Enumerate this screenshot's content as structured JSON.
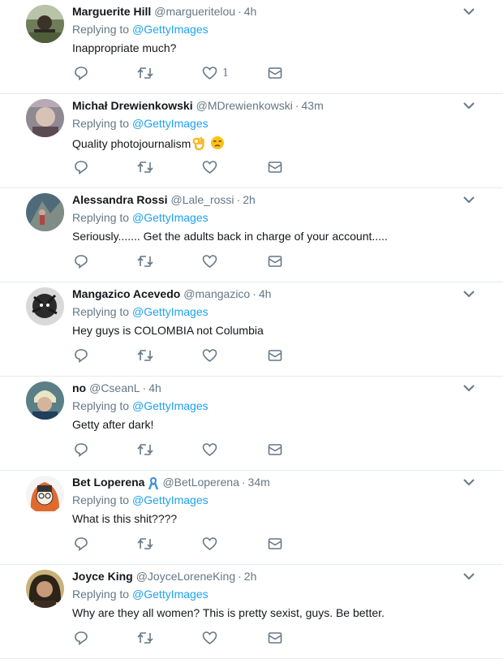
{
  "tweets": [
    {
      "name": "Marguerite Hill",
      "handle": "@margueritelou",
      "sep": "·",
      "time": "4h",
      "replying_prefix": "Replying to",
      "replying_to": "@GettyImages",
      "text": "Inappropriate much?",
      "like_count": "1"
    },
    {
      "name": "Michał Drewienkowski",
      "handle": "@MDrewienkowski",
      "sep": "·",
      "time": "43m",
      "replying_prefix": "Replying to",
      "replying_to": "@GettyImages",
      "text": "Quality photojournalism",
      "like_count": ""
    },
    {
      "name": "Alessandra Rossi",
      "handle": "@Lale_rossi",
      "sep": "·",
      "time": "2h",
      "replying_prefix": "Replying to",
      "replying_to": "@GettyImages",
      "text": "Seriously....... Get the adults back in charge of your account.....",
      "like_count": ""
    },
    {
      "name": "Mangazico Acevedo",
      "handle": "@mangazico",
      "sep": "·",
      "time": "4h",
      "replying_prefix": "Replying to",
      "replying_to": "@GettyImages",
      "text": "Hey guys is COLOMBIA not Columbia",
      "like_count": ""
    },
    {
      "name": "no",
      "handle": "@CseanL",
      "sep": "·",
      "time": "4h",
      "replying_prefix": "Replying to",
      "replying_to": "@GettyImages",
      "text": "Getty after dark!",
      "like_count": ""
    },
    {
      "name": "Bet Loperena",
      "handle": "@BetLoperena",
      "sep": "·",
      "time": "34m",
      "replying_prefix": "Replying to",
      "replying_to": "@GettyImages",
      "text": "What is this shit????",
      "like_count": ""
    },
    {
      "name": "Joyce King",
      "handle": "@JoyceLoreneKing",
      "sep": "·",
      "time": "2h",
      "replying_prefix": "Replying to",
      "replying_to": "@GettyImages",
      "text": "Why are they all women? This is pretty sexist, guys. Be better.",
      "like_count": ""
    }
  ],
  "icons": {
    "reply": "reply-icon",
    "retweet": "retweet-icon",
    "like": "heart-icon",
    "dm": "envelope-icon",
    "more": "chevron-down-icon",
    "ribbon": "ribbon-icon",
    "ok_hand": "ok-hand-emoji",
    "face": "unamused-face-emoji"
  },
  "colors": {
    "link": "#1da1f2",
    "muted": "#657786",
    "text": "#14171a",
    "divider": "#e6ecf0"
  }
}
